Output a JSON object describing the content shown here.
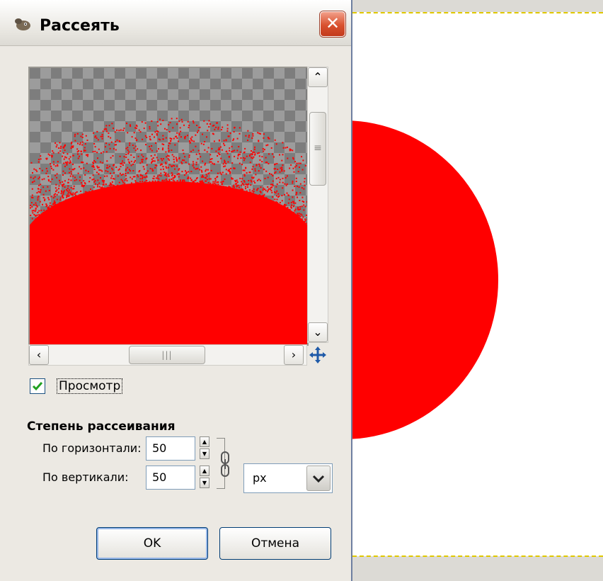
{
  "window": {
    "title": "Рассеять",
    "close_label": "✕"
  },
  "preview": {
    "checkbox_label": "Просмотр",
    "checked": true,
    "colors": {
      "fill": "#ff0000",
      "checker_dark": "#7d7d7d",
      "checker_light": "#9c9c9c"
    }
  },
  "spread": {
    "section_title": "Степень рассеивания",
    "horizontal_label": "По горизонтали:",
    "horizontal_value": "50",
    "vertical_label": "По вертикали:",
    "vertical_value": "50",
    "unit": "px"
  },
  "buttons": {
    "ok_label": "OK",
    "cancel_label": "Отмена"
  },
  "canvas": {
    "shape_color": "#ff0000",
    "selection_color": "#e0c800"
  }
}
